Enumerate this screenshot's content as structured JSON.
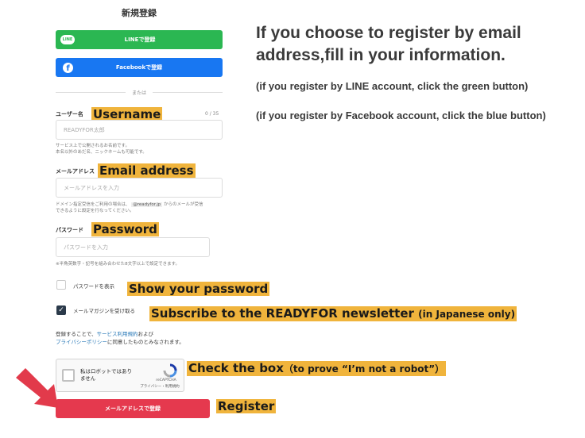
{
  "form": {
    "title": "新規登録",
    "line_button": {
      "logo": "LINE",
      "label": "LINEで登録"
    },
    "facebook_button": {
      "logo": "f",
      "label": "Facebookで登録"
    },
    "divider_text": "または",
    "username": {
      "label": "ユーザー名",
      "annotation": "Username",
      "counter": "0 / 35",
      "placeholder": "READYFOR太郎",
      "help": [
        "サービス上で公開されるお名前です。",
        "本名以外のあだ名、ニックネームも可能です。"
      ]
    },
    "email": {
      "label": "メールアドレス",
      "annotation": "Email address",
      "placeholder": "メールアドレスを入力",
      "help_before": "ドメイン指定受信をご利用の場合は、",
      "help_domain": "@readyfor.jp",
      "help_after": "からのメールが受信",
      "help_line2": "できるように設定を行なってください。"
    },
    "password": {
      "label": "パスワード",
      "annotation": "Password",
      "placeholder": "パスワードを入力",
      "help": "※半角英数字・記号を組み合わせた8文字以上で設定できます。"
    },
    "show_password": {
      "label": "パスワードを表示",
      "checked": false,
      "annotation": "Show your password"
    },
    "newsletter": {
      "label": "メールマガジンを受け取る",
      "checked": true,
      "annotation_main": "Subscribe to the READYFOR newsletter",
      "annotation_small": "(in Japanese only)"
    },
    "terms": {
      "prefix": "登録することで、",
      "service_terms_link": "サービス利用規約",
      "and": "および",
      "privacy_link": "プライバシーポリシー",
      "suffix": "に同意したものとみなされます。"
    },
    "captcha": {
      "label_line1": "私はロボットではあり",
      "label_line2": "ません",
      "brand": "reCAPTCHA",
      "links": "プライバシー・利用規約",
      "annotation_main": "Check the box",
      "annotation_small": "（to prove “I’m not a robot”）"
    },
    "register_button": {
      "label": "メールアドレスで登録",
      "annotation": "Register"
    }
  },
  "instructions": {
    "heading_line1": "If you choose to register by email",
    "heading_line2": "address,fill in your information.",
    "note_line": "(if you register by LINE account, click the green button)",
    "note_facebook": "(if you register by Facebook account, click the blue button)"
  },
  "colors": {
    "line_green": "#2bb752",
    "facebook_blue": "#1877f2",
    "register_red": "#e5394e",
    "annotation_highlight": "#f0b43c",
    "arrow_red": "#e23a4b"
  },
  "icons": [
    "line-logo-icon",
    "facebook-logo-icon",
    "checkmark-icon",
    "recaptcha-icon",
    "red-arrow-icon"
  ]
}
